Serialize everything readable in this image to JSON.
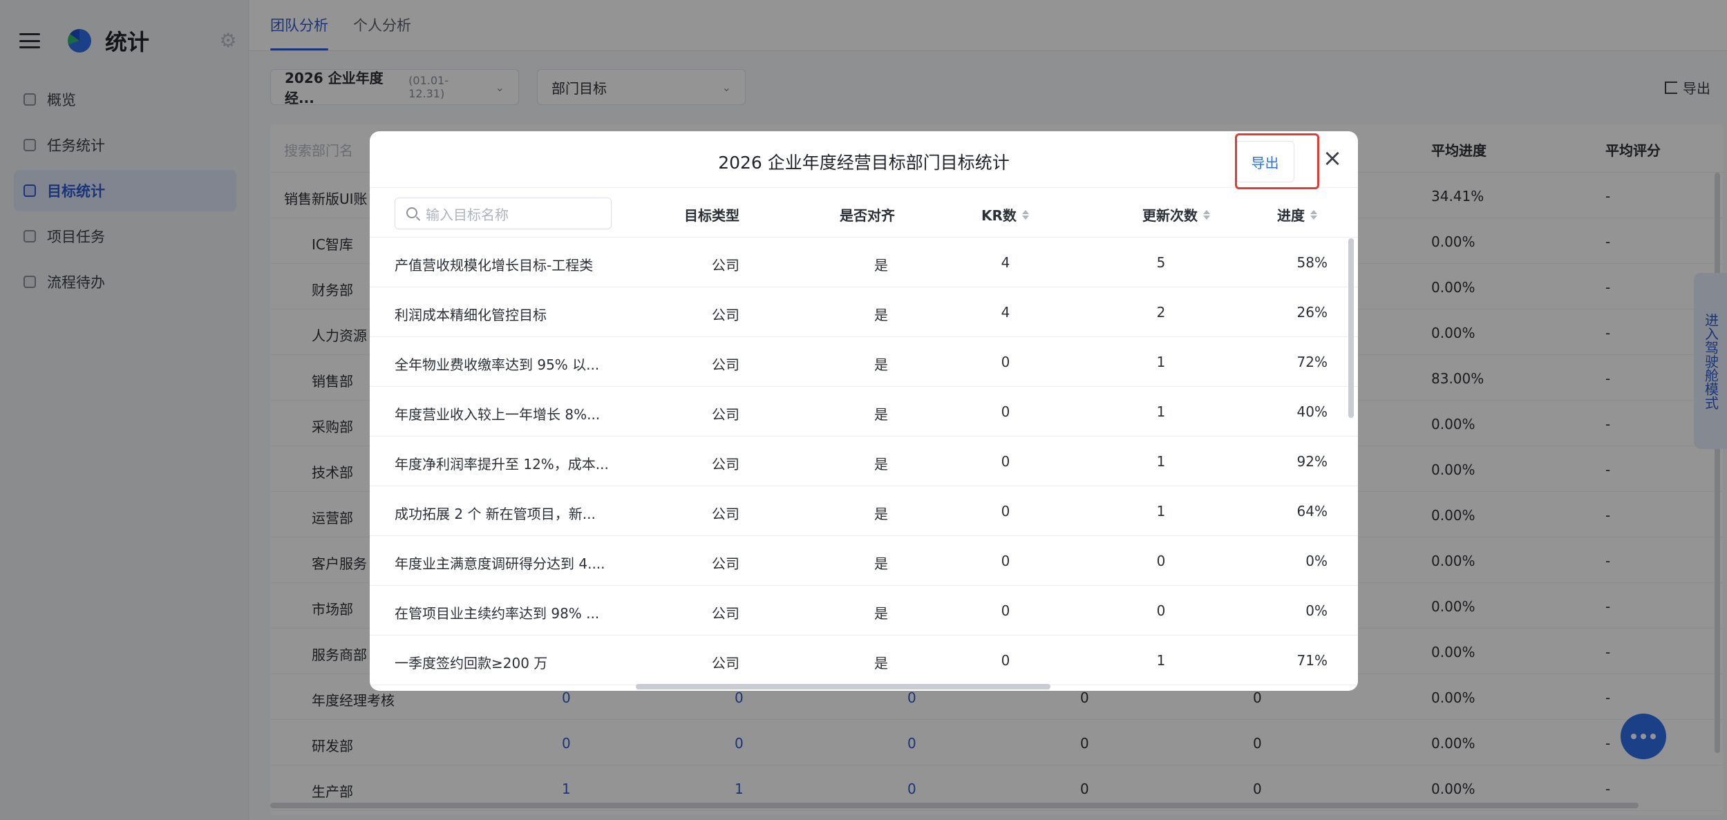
{
  "app": {
    "title": "统计"
  },
  "sidebar": {
    "items": [
      {
        "label": "概览",
        "active": false
      },
      {
        "label": "任务统计",
        "active": false
      },
      {
        "label": "目标统计",
        "active": true
      },
      {
        "label": "项目任务",
        "active": false
      },
      {
        "label": "流程待办",
        "active": false
      }
    ]
  },
  "tabs": [
    {
      "label": "团队分析",
      "active": true
    },
    {
      "label": "个人分析",
      "active": false
    }
  ],
  "filters": {
    "period": "2026 企业年度经...",
    "period_range": "(01.01-12.31)",
    "target_type": "部门目标"
  },
  "export_top_label": "导出",
  "background_table": {
    "search_placeholder": "搜索部门名",
    "headers": {
      "avg_progress": "平均进度",
      "avg_score": "平均评分"
    },
    "rows": [
      {
        "name": "销售新版UI账",
        "c1": "",
        "c2": "",
        "c3": "",
        "c4": "",
        "c5": "",
        "progress": "34.41%",
        "score": "-"
      },
      {
        "name": "IC智库",
        "c1": "",
        "c2": "",
        "c3": "",
        "c4": "",
        "c5": "",
        "progress": "0.00%",
        "score": "-"
      },
      {
        "name": "财务部",
        "c1": "",
        "c2": "",
        "c3": "",
        "c4": "",
        "c5": "",
        "progress": "0.00%",
        "score": "-"
      },
      {
        "name": "人力资源",
        "c1": "",
        "c2": "",
        "c3": "",
        "c4": "",
        "c5": "",
        "progress": "0.00%",
        "score": "-"
      },
      {
        "name": "销售部",
        "c1": "",
        "c2": "",
        "c3": "",
        "c4": "",
        "c5": "",
        "progress": "83.00%",
        "score": "-"
      },
      {
        "name": "采购部",
        "c1": "",
        "c2": "",
        "c3": "",
        "c4": "",
        "c5": "",
        "progress": "0.00%",
        "score": "-"
      },
      {
        "name": "技术部",
        "c1": "",
        "c2": "",
        "c3": "",
        "c4": "",
        "c5": "",
        "progress": "0.00%",
        "score": "-"
      },
      {
        "name": "运营部",
        "c1": "",
        "c2": "",
        "c3": "",
        "c4": "",
        "c5": "",
        "progress": "0.00%",
        "score": "-"
      },
      {
        "name": "客户服务",
        "c1": "",
        "c2": "",
        "c3": "",
        "c4": "",
        "c5": "",
        "progress": "0.00%",
        "score": "-"
      },
      {
        "name": "市场部",
        "c1": "",
        "c2": "",
        "c3": "",
        "c4": "",
        "c5": "",
        "progress": "0.00%",
        "score": "-"
      },
      {
        "name": "服务商部",
        "c1": "",
        "c2": "",
        "c3": "",
        "c4": "",
        "c5": "",
        "progress": "0.00%",
        "score": "-"
      },
      {
        "name": "年度经理考核",
        "c1": "0",
        "c2": "0",
        "c3": "0",
        "c4": "0",
        "c5": "0",
        "progress": "0.00%",
        "score": "-"
      },
      {
        "name": "研发部",
        "c1": "0",
        "c2": "0",
        "c3": "0",
        "c4": "0",
        "c5": "0",
        "progress": "0.00%",
        "score": "-"
      },
      {
        "name": "生产部",
        "c1": "1",
        "c2": "1",
        "c3": "0",
        "c4": "0",
        "c5": "0",
        "progress": "0.00%",
        "score": "-"
      }
    ]
  },
  "side_tab": "进入驾驶舱模式",
  "modal": {
    "title": "2026 企业年度经营目标部门目标统计",
    "export_label": "导出",
    "search_placeholder": "输入目标名称",
    "columns": {
      "type": "目标类型",
      "aligned": "是否对齐",
      "kr": "KR数",
      "updates": "更新次数",
      "progress": "进度"
    },
    "rows": [
      {
        "name": "产值营收规模化增长目标-工程类",
        "type": "公司",
        "aligned": "是",
        "kr": "4",
        "updates": "5",
        "progress": "58%"
      },
      {
        "name": "利润成本精细化管控目标",
        "type": "公司",
        "aligned": "是",
        "kr": "4",
        "updates": "2",
        "progress": "26%"
      },
      {
        "name": "全年物业费收缴率达到 95% 以...",
        "type": "公司",
        "aligned": "是",
        "kr": "0",
        "updates": "1",
        "progress": "72%"
      },
      {
        "name": "年度营业收入较上一年增长 8%...",
        "type": "公司",
        "aligned": "是",
        "kr": "0",
        "updates": "1",
        "progress": "40%"
      },
      {
        "name": "年度净利润率提升至 12%，成本...",
        "type": "公司",
        "aligned": "是",
        "kr": "0",
        "updates": "1",
        "progress": "92%"
      },
      {
        "name": "成功拓展 2 个 新在管项目，新...",
        "type": "公司",
        "aligned": "是",
        "kr": "0",
        "updates": "1",
        "progress": "64%"
      },
      {
        "name": "年度业主满意度调研得分达到 4....",
        "type": "公司",
        "aligned": "是",
        "kr": "0",
        "updates": "0",
        "progress": "0%"
      },
      {
        "name": "在管项目业主续约率达到 98% ...",
        "type": "公司",
        "aligned": "是",
        "kr": "0",
        "updates": "0",
        "progress": "0%"
      },
      {
        "name": "一季度签约回款≥200 万",
        "type": "公司",
        "aligned": "是",
        "kr": "0",
        "updates": "1",
        "progress": "71%"
      }
    ]
  },
  "colors": {
    "accent": "#2d5bd3",
    "highlight": "#e53935"
  }
}
